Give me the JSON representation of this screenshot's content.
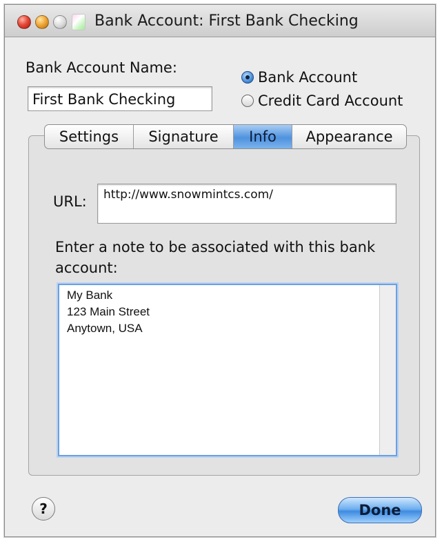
{
  "window": {
    "title": "Bank Account: First Bank Checking"
  },
  "form": {
    "name_label": "Bank Account Name:",
    "name_value": "First Bank Checking",
    "type_options": [
      {
        "label": "Bank Account",
        "selected": true
      },
      {
        "label": "Credit Card Account",
        "selected": false
      }
    ]
  },
  "tabs": [
    {
      "label": "Settings",
      "active": false
    },
    {
      "label": "Signature",
      "active": false
    },
    {
      "label": "Info",
      "active": true
    },
    {
      "label": "Appearance",
      "active": false
    }
  ],
  "info": {
    "url_label": "URL:",
    "url_value": "http://www.snowmintcs.com/",
    "note_label": "Enter a note to be associated with this bank account:",
    "note_value": "My Bank\n123 Main Street\nAnytown, USA"
  },
  "footer": {
    "help_glyph": "?",
    "done_label": "Done"
  },
  "colors": {
    "accent": "#4f92de",
    "close": "#e5493a",
    "minimize": "#f2a93a"
  }
}
